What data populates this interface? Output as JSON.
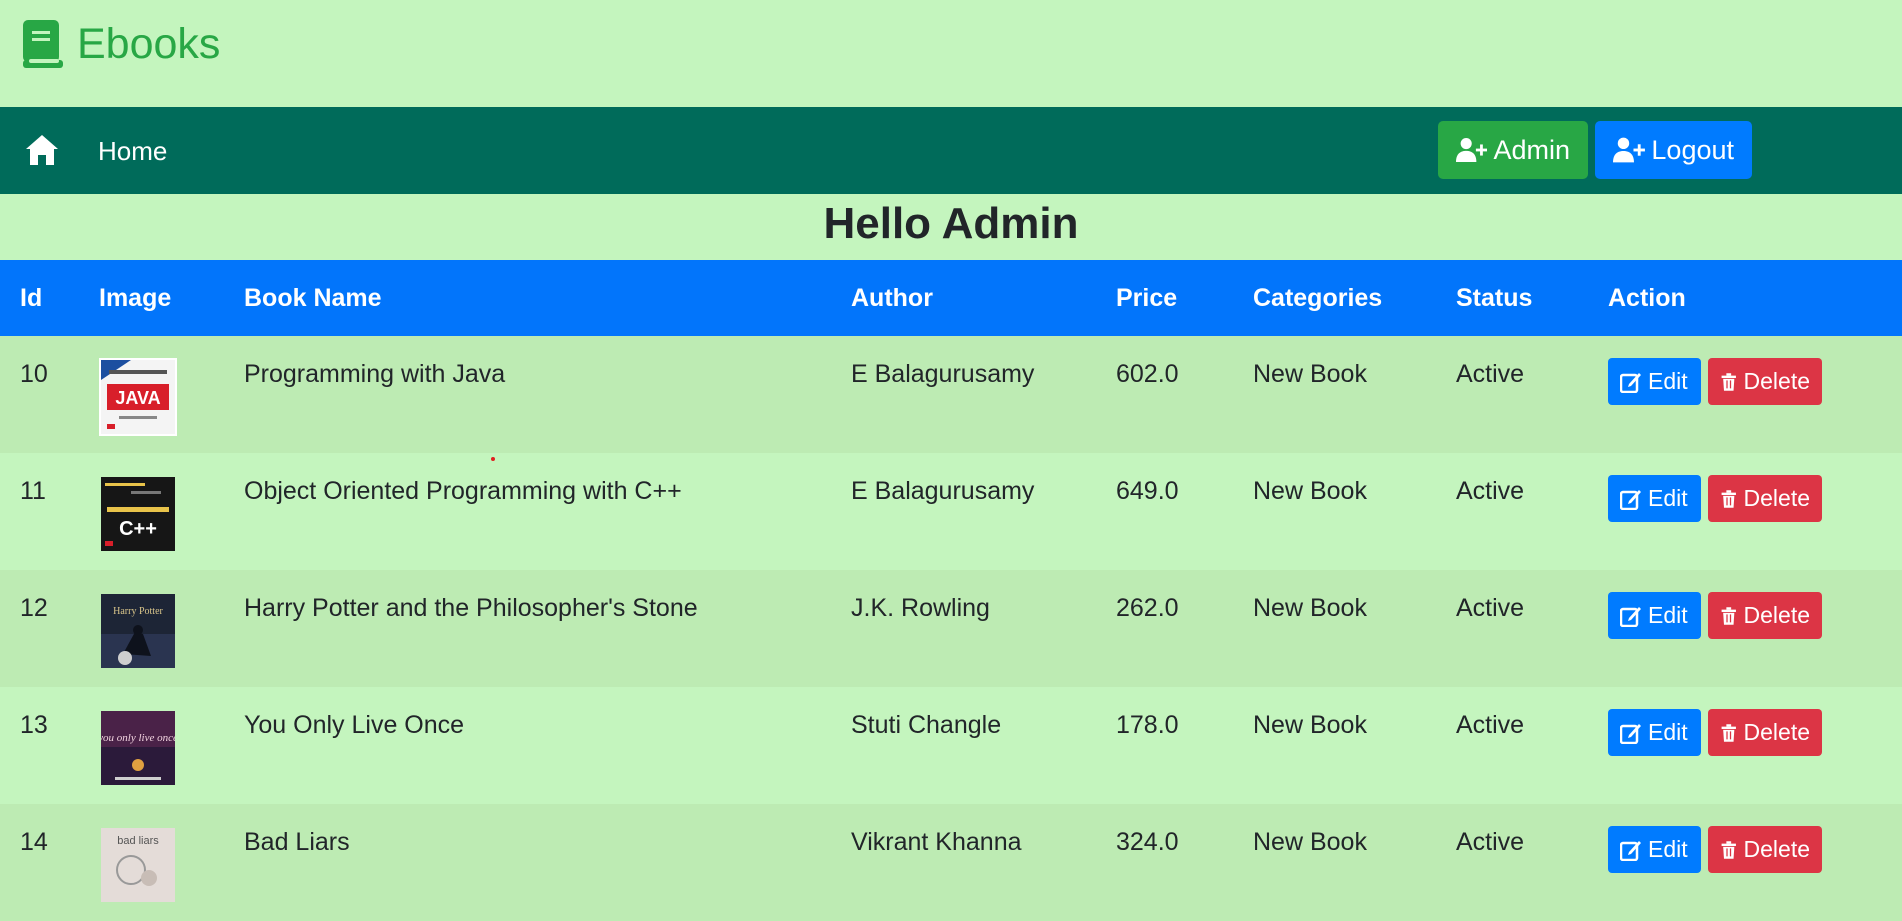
{
  "brand": {
    "name": "Ebooks",
    "icon": "book-icon",
    "color": "#28a745"
  },
  "nav": {
    "home_label": "Home",
    "admin_label": "Admin",
    "logout_label": "Logout",
    "bg_color": "#006b5a"
  },
  "greeting": "Hello Admin",
  "table": {
    "headers": {
      "id": "Id",
      "image": "Image",
      "name": "Book Name",
      "author": "Author",
      "price": "Price",
      "category": "Categories",
      "status": "Status",
      "action": "Action"
    },
    "edit_label": "Edit",
    "delete_label": "Delete",
    "rows": [
      {
        "id": "10",
        "name": "Programming with Java",
        "author": "E Balagurusamy",
        "price": "602.0",
        "category": "New Book",
        "status": "Active",
        "cover_text": "JAVA"
      },
      {
        "id": "11",
        "name": "Object Oriented Programming with C++",
        "author": "E Balagurusamy",
        "price": "649.0",
        "category": "New Book",
        "status": "Active",
        "cover_text": "C++"
      },
      {
        "id": "12",
        "name": "Harry Potter and the Philosopher's Stone",
        "author": "J.K. Rowling",
        "price": "262.0",
        "category": "New Book",
        "status": "Active",
        "cover_text": "Harry Potter"
      },
      {
        "id": "13",
        "name": "You Only Live Once",
        "author": "Stuti Changle",
        "price": "178.0",
        "category": "New Book",
        "status": "Active",
        "cover_text": "you only live once"
      },
      {
        "id": "14",
        "name": "Bad Liars",
        "author": "Vikrant Khanna",
        "price": "324.0",
        "category": "New Book",
        "status": "Active",
        "cover_text": "bad liars"
      }
    ]
  }
}
